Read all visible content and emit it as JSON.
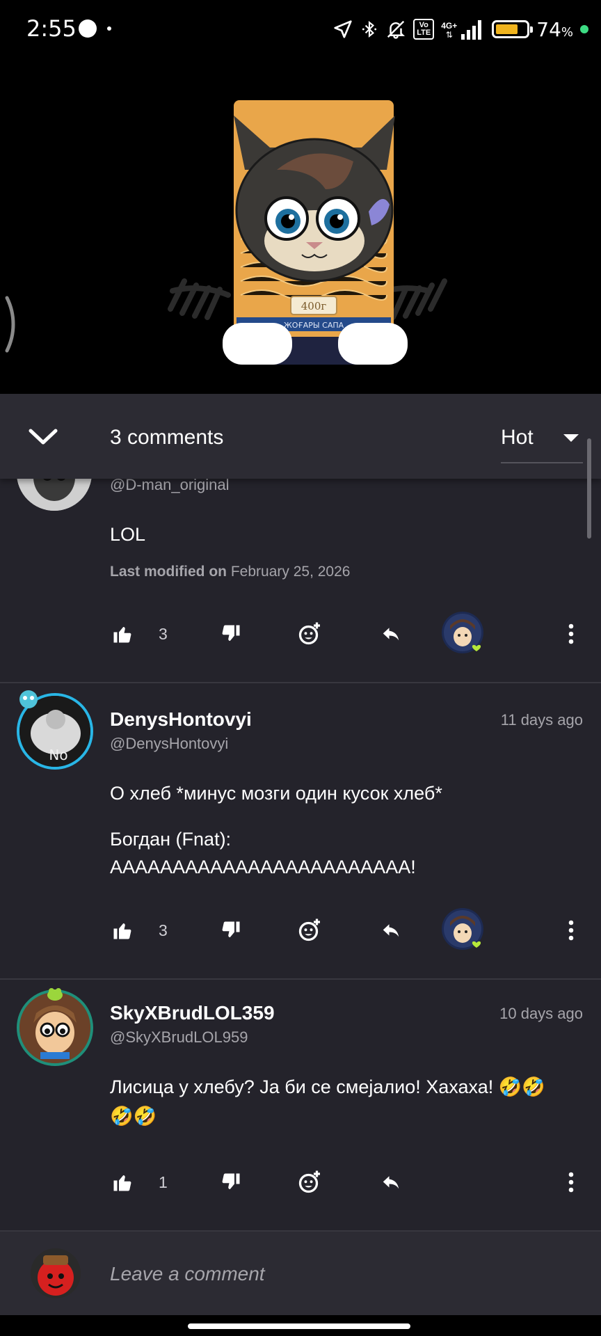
{
  "status_bar": {
    "time": "2:55",
    "network_label_top": "4G+",
    "volte_top": "Vo",
    "volte_bottom": "LTE",
    "battery_percent": "74",
    "battery_percent_suffix": "%",
    "battery_level": 0.74,
    "battery_color": "#f0b41e",
    "privacy_dot_color": "#3ddc84"
  },
  "video": {
    "package_label": "400г",
    "package_band_text": "ЖОҒАРЫ САПА"
  },
  "comments_header": {
    "count_label": "3 comments",
    "sort_label": "Hot"
  },
  "comments": [
    {
      "handle": "@D-man_original",
      "body": "LOL",
      "modified_prefix": "Last modified on",
      "modified_date": "February 25, 2026",
      "likes": "3"
    },
    {
      "username": "DenysHontovyi",
      "handle": "@DenysHontovyi",
      "timestamp": "11 days ago",
      "body_line1": "О хлеб *минус мозги один кусок хлеб*",
      "body_line2": "Богдан (Fnat):",
      "body_line3": "АААААААААААААААААААААААА!",
      "likes": "3",
      "avatar_text": "No"
    },
    {
      "username": "SkyXBrudLOL359",
      "handle": "@SkyXBrudLOL959",
      "timestamp": "10 days ago",
      "body_line1": "Лисица у хлебу? Ја би се смејалио! Хахаха! 🤣🤣",
      "body_line2": "🤣🤣",
      "likes": "1"
    }
  ],
  "comment_input": {
    "placeholder": "Leave a comment"
  },
  "colors": {
    "sheet_background": "#24232b",
    "header_background": "#2c2b33",
    "secondary_text": "#a6a5ab",
    "heart_badge": "#b6e83a"
  }
}
